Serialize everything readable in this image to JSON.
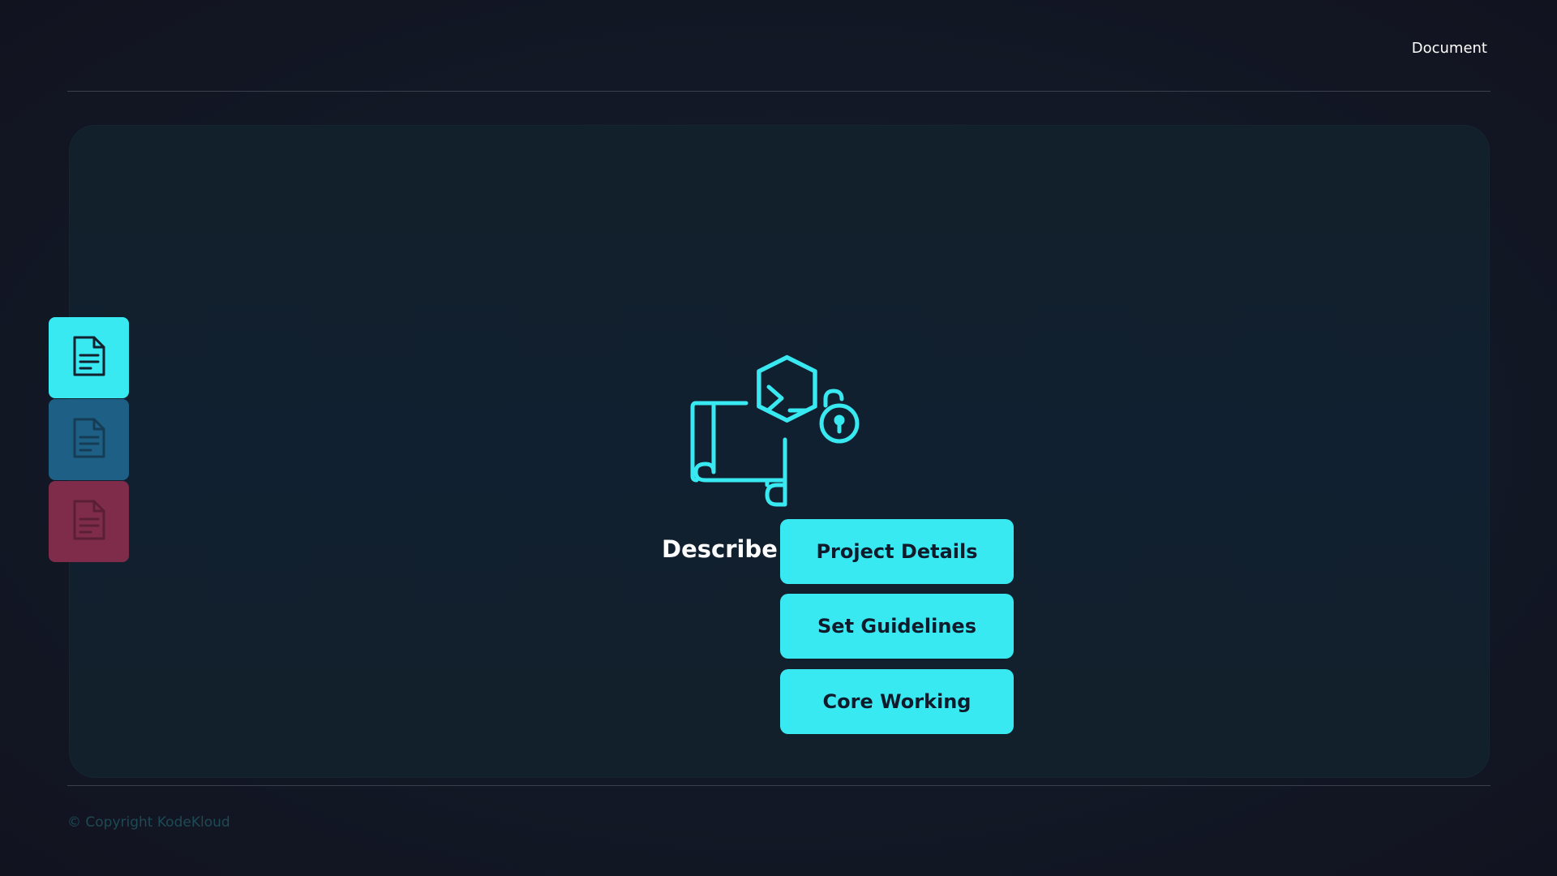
{
  "header": {
    "title": "Document"
  },
  "sidebar": {
    "tabs": [
      {
        "icon": "document-icon",
        "bg": "#38e9f1",
        "fg": "#13202e"
      },
      {
        "icon": "document-icon",
        "bg": "#1e5f85",
        "fg": "#173c55"
      },
      {
        "icon": "document-icon",
        "bg": "#7e2c4a",
        "fg": "#5a1f35"
      }
    ]
  },
  "main": {
    "hero_icon": "script-terminal-lock-icon",
    "describe_label": "Describe:",
    "buttons": [
      {
        "label": "Project Details"
      },
      {
        "label": "Set Guidelines"
      },
      {
        "label": "Core Working"
      }
    ]
  },
  "footer": {
    "copyright": "© Copyright KodeKloud"
  },
  "colors": {
    "accent": "#38e9f1",
    "background": "#131826",
    "panel": "#112030"
  }
}
